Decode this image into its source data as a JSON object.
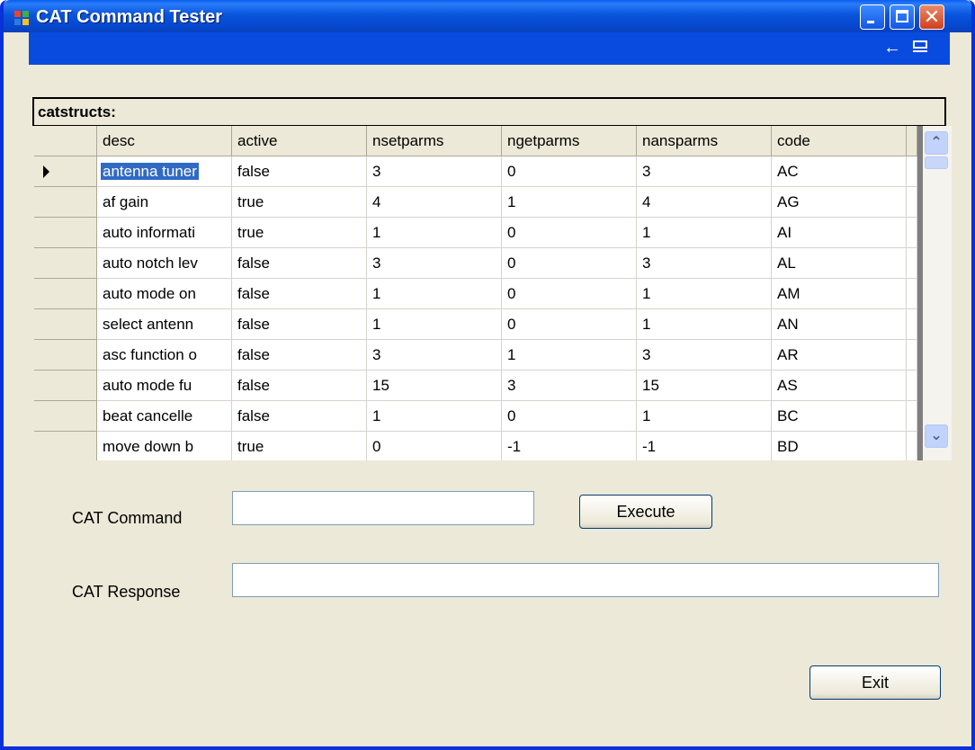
{
  "window": {
    "title": "CAT Command Tester",
    "accent_color": "#0a4bdf",
    "icons": [
      "app-icon",
      "minimize-icon",
      "maximize-icon",
      "close-icon"
    ]
  },
  "navigator": {
    "icons": [
      "back-arrow-icon",
      "menu-icon"
    ]
  },
  "grid": {
    "caption": "catstructs:",
    "columns": [
      "desc",
      "active",
      "nsetparms",
      "ngetparms",
      "nansparms",
      "code"
    ],
    "rows": [
      [
        "antenna tuner",
        "false",
        "3",
        "0",
        "3",
        "AC"
      ],
      [
        "af gain",
        "true",
        "4",
        "1",
        "4",
        "AG"
      ],
      [
        "auto informati",
        "true",
        "1",
        "0",
        "1",
        "AI"
      ],
      [
        "auto notch lev",
        "false",
        "3",
        "0",
        "3",
        "AL"
      ],
      [
        "auto mode on",
        "false",
        "1",
        "0",
        "1",
        "AM"
      ],
      [
        "select antenn",
        "false",
        "1",
        "0",
        "1",
        "AN"
      ],
      [
        "asc function o",
        "false",
        "3",
        "1",
        "3",
        "AR"
      ],
      [
        "auto mode fu",
        "false",
        "15",
        "3",
        "15",
        "AS"
      ],
      [
        "beat cancelle",
        "false",
        "1",
        "0",
        "1",
        "BC"
      ],
      [
        "move down b",
        "true",
        "0",
        "-1",
        "-1",
        "BD"
      ]
    ],
    "selected_row": 0
  },
  "form": {
    "command_label": "CAT Command",
    "command_value": "",
    "response_label": "CAT Response",
    "response_value": "",
    "execute_label": "Execute",
    "exit_label": "Exit"
  }
}
